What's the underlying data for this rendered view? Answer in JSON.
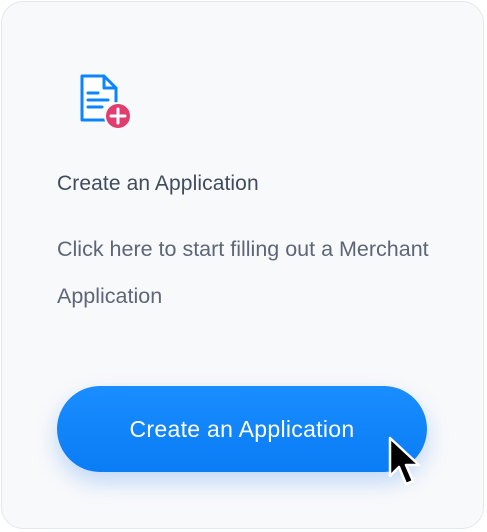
{
  "card": {
    "icon": "document-add-icon",
    "title": "Create an Application",
    "description": "Click here to start filling out a Merchant Application",
    "button_label": "Create an Application"
  },
  "colors": {
    "accent": "#0a84ff",
    "badge": "#e23d6f",
    "title_text": "#404b5e",
    "body_text": "#5d6678",
    "card_border": "#e3e7ef"
  }
}
